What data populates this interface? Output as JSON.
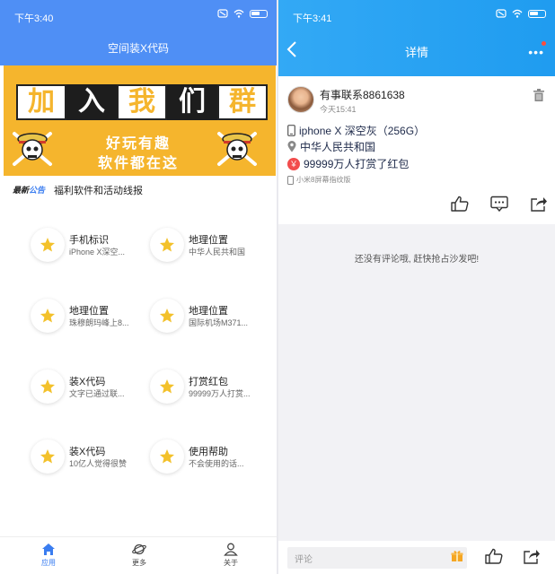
{
  "left": {
    "status_time": "下午3:40",
    "header_title": "空间装X代码",
    "banner": {
      "chars": [
        "加",
        "入",
        "我",
        "们",
        "群"
      ],
      "line1": "好玩有趣",
      "line2": "软件都在这"
    },
    "notice": {
      "badge_a": "最新",
      "badge_b": "公告",
      "text": "福利软件和活动线报"
    },
    "grid": [
      {
        "title": "手机标识",
        "subtitle": "iPhone X深空..."
      },
      {
        "title": "地理位置",
        "subtitle": "中华人民共和国"
      },
      {
        "title": "地理位置",
        "subtitle": "珠穆朗玛峰上8..."
      },
      {
        "title": "地理位置",
        "subtitle": "国际机场M371..."
      },
      {
        "title": "装X代码",
        "subtitle": "文字已通过联..."
      },
      {
        "title": "打赏红包",
        "subtitle": "99999万人打赏..."
      },
      {
        "title": "装X代码",
        "subtitle": "10亿人觉得很赞"
      },
      {
        "title": "使用帮助",
        "subtitle": "不会使用的话..."
      }
    ],
    "nav": [
      {
        "label": "应用",
        "icon": "home-icon"
      },
      {
        "label": "更多",
        "icon": "planet-icon"
      },
      {
        "label": "关于",
        "icon": "person-icon"
      }
    ]
  },
  "right": {
    "status_time": "下午3:41",
    "header_title": "详情",
    "more_label": "•••",
    "post": {
      "user": "有事联系8861638",
      "time": "今天15:41",
      "device": "iphone X 深空灰（256G）",
      "location": "中华人民共和国",
      "reward_symbol": "￥",
      "reward": "99999万人打赏了红包",
      "source": "小米8屏幕指纹版"
    },
    "empty_text": "还没有评论哦, 赶快抢占沙发吧!",
    "comment_placeholder": "评论"
  },
  "colors": {
    "left_header": "#4f8ff5",
    "banner": "#f5b52d",
    "right_header": "#1f9cf0",
    "accent": "#3a7df0",
    "reward": "#f24c4c"
  }
}
